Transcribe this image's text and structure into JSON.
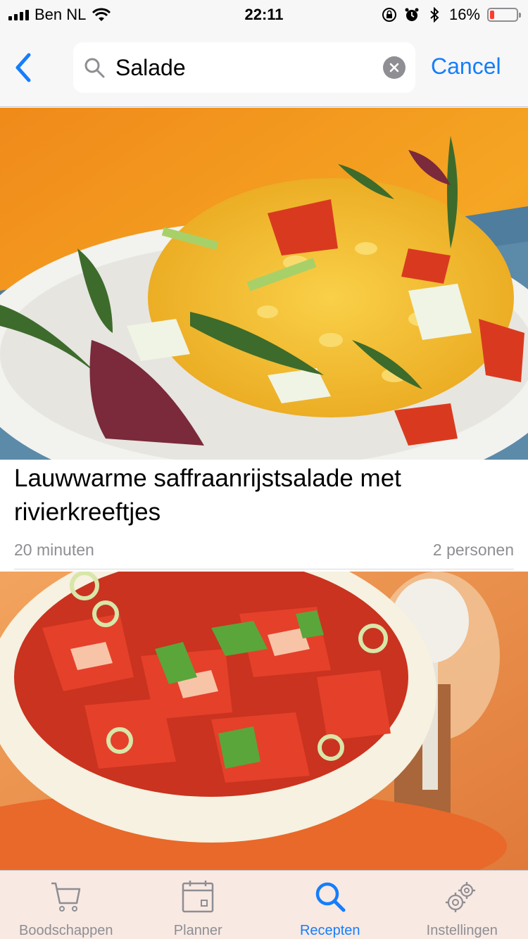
{
  "status_bar": {
    "carrier": "Ben NL",
    "time": "22:11",
    "battery_percent": "16%",
    "battery_level": 0.16,
    "icons": [
      "signal-icon",
      "wifi-icon",
      "orientation-lock-icon",
      "alarm-icon",
      "bluetooth-icon",
      "battery-icon"
    ]
  },
  "search": {
    "value": "Salade",
    "cancel_label": "Cancel",
    "icons": [
      "back-chevron-icon",
      "search-icon",
      "clear-icon"
    ]
  },
  "recipes": [
    {
      "title": "Lauwwarme saffraanrijstsalade met rivierkreeftjes",
      "time": "20 minuten",
      "persons": "2 personen"
    }
  ],
  "tab_bar": {
    "tabs": [
      {
        "label": "Boodschappen",
        "icon": "cart-icon",
        "active": false
      },
      {
        "label": "Planner",
        "icon": "calendar-icon",
        "active": false
      },
      {
        "label": "Recepten",
        "icon": "search-icon",
        "active": true
      },
      {
        "label": "Instellingen",
        "icon": "gear-icon",
        "active": false
      }
    ]
  },
  "colors": {
    "accent": "#157efb",
    "inactive": "#8e8e93",
    "battery_low": "#ff3b30"
  }
}
